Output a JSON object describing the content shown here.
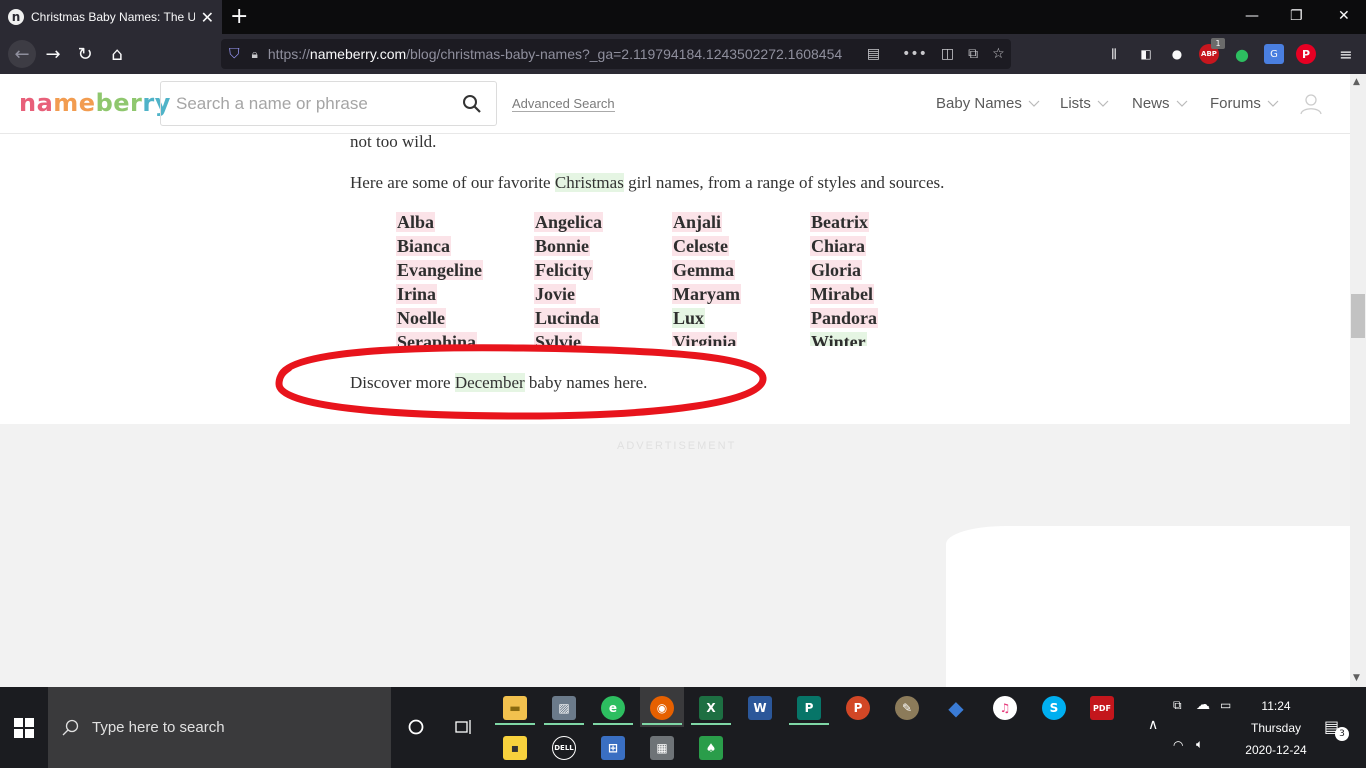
{
  "browser": {
    "tab_title": "Christmas Baby Names: The Ulti",
    "tab_favicon": "n",
    "url_prefix": "https://",
    "url_domain": "nameberry.com",
    "url_path": "/blog/christmas-baby-names?_ga=2.119794184.1243502272.1608454",
    "abp_badge": "1",
    "abp_label": "ABP"
  },
  "site": {
    "logo": [
      "na",
      "me",
      "ber",
      "ry"
    ],
    "search_placeholder": "Search a name or phrase",
    "advanced_search": "Advanced Search",
    "menu": [
      "Baby Names",
      "Lists",
      "News",
      "Forums"
    ]
  },
  "article": {
    "top_fragment": "not too wild.",
    "intro_before": "Here are some of our favorite ",
    "intro_link": "Christmas",
    "intro_after": " girl names, from a range of styles and sources.",
    "names": [
      [
        "Alba",
        "Angelica",
        "Anjali",
        "Beatrix"
      ],
      [
        "Bianca",
        "Bonnie",
        "Celeste",
        "Chiara"
      ],
      [
        "Evangeline",
        "Felicity",
        "Gemma",
        "Gloria"
      ],
      [
        "Irina",
        "Jovie",
        "Maryam",
        "Mirabel"
      ],
      [
        "Noelle",
        "Lucinda",
        "Lux",
        "Pandora"
      ],
      [
        "Seraphina",
        "Sylvie",
        "Virginia",
        "Winter"
      ]
    ],
    "green_names": [
      "Lux",
      "Winter"
    ],
    "discover_before": "Discover more ",
    "discover_link": "December",
    "discover_after": " baby names here."
  },
  "ad_label": "ADVERTISEMENT",
  "taskbar": {
    "search_text": "Type here to search",
    "time": "11:24",
    "day": "Thursday",
    "date": "2020-12-24",
    "notifications": "3"
  },
  "colors": {
    "name_pink": "#fbe3e8",
    "name_green": "#e5f5e3",
    "annotation_red": "#e8141c"
  }
}
